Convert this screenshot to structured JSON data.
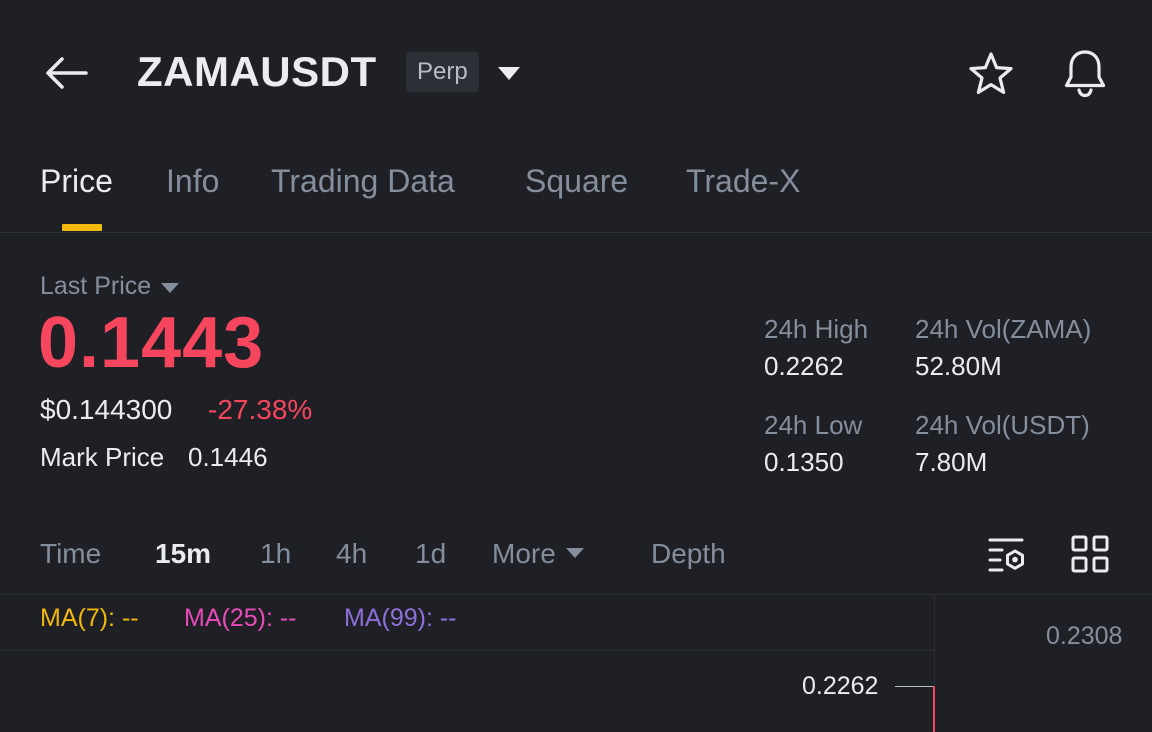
{
  "header": {
    "symbol": "ZAMAUSDT",
    "contract_type": "Perp",
    "icons": [
      "back-arrow-icon",
      "chevron-down-icon",
      "star-icon",
      "bell-icon"
    ]
  },
  "tabs": [
    {
      "label": "Price",
      "active": true
    },
    {
      "label": "Info",
      "active": false
    },
    {
      "label": "Trading Data",
      "active": false
    },
    {
      "label": "Square",
      "active": false
    },
    {
      "label": "Trade-X",
      "active": false
    }
  ],
  "price": {
    "last_price_label": "Last Price",
    "last_price": "0.1443",
    "usd_price": "$0.144300",
    "change_pct": "-27.38%",
    "mark_price_label": "Mark Price",
    "mark_price": "0.1446"
  },
  "stats": {
    "high_label": "24h High",
    "high_value": "0.2262",
    "low_label": "24h Low",
    "low_value": "0.1350",
    "vol_base_label": "24h Vol(ZAMA)",
    "vol_base_value": "52.80M",
    "vol_quote_label": "24h Vol(USDT)",
    "vol_quote_value": "7.80M"
  },
  "intervals": {
    "time": "Time",
    "m15": "15m",
    "h1": "1h",
    "h4": "4h",
    "d1": "1d",
    "more": "More",
    "depth": "Depth",
    "active": "15m"
  },
  "chart": {
    "ma7": "MA(7): --",
    "ma25": "MA(25): --",
    "ma99": "MA(99): --",
    "axis_top": "0.2308",
    "high_marker": "0.2262"
  },
  "colors": {
    "background": "#1e2026",
    "accent": "#f0b90b",
    "down": "#f6465d",
    "ma7": "#f0b90b",
    "ma25": "#e84ab7",
    "ma99": "#8e6fd9"
  }
}
